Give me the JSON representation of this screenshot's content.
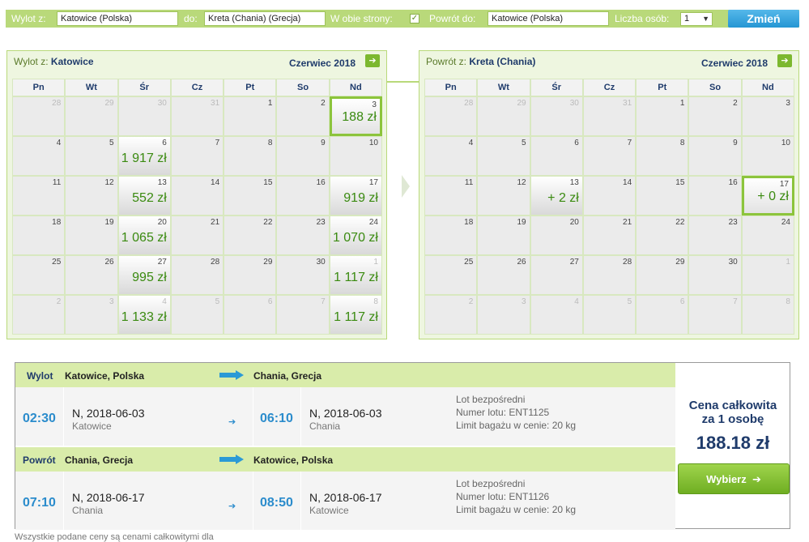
{
  "search": {
    "from_label": "Wylot z:",
    "from_value": "Katowice (Polska)",
    "to_label": "do:",
    "to_value": "Kreta (Chania) (Grecja)",
    "roundtrip_label": "W obie strony:",
    "roundtrip_checked": "✓",
    "return_label": "Powrót do:",
    "return_value": "Katowice (Polska)",
    "persons_label": "Liczba osób:",
    "persons_value": "1",
    "submit": "Zmień"
  },
  "weekdays": [
    "Pn",
    "Wt",
    "Śr",
    "Cz",
    "Pt",
    "So",
    "Nd"
  ],
  "outbound": {
    "title_prefix": "Wylot z:",
    "title_city": "Katowice",
    "month": "Czerwiec 2018",
    "next_icon": "arrow-right-icon",
    "days": [
      {
        "n": "28",
        "f": 1
      },
      {
        "n": "29",
        "f": 1
      },
      {
        "n": "30",
        "f": 1
      },
      {
        "n": "31",
        "f": 1
      },
      {
        "n": "1"
      },
      {
        "n": "2"
      },
      {
        "n": "3",
        "p": "188 zł",
        "s": 1
      },
      {
        "n": "4"
      },
      {
        "n": "5"
      },
      {
        "n": "6",
        "p": "1 917 zł"
      },
      {
        "n": "7"
      },
      {
        "n": "8"
      },
      {
        "n": "9"
      },
      {
        "n": "10"
      },
      {
        "n": "11"
      },
      {
        "n": "12"
      },
      {
        "n": "13",
        "p": "552 zł"
      },
      {
        "n": "14"
      },
      {
        "n": "15"
      },
      {
        "n": "16"
      },
      {
        "n": "17",
        "p": "919 zł"
      },
      {
        "n": "18"
      },
      {
        "n": "19"
      },
      {
        "n": "20",
        "p": "1 065 zł"
      },
      {
        "n": "21"
      },
      {
        "n": "22"
      },
      {
        "n": "23"
      },
      {
        "n": "24",
        "p": "1 070 zł"
      },
      {
        "n": "25"
      },
      {
        "n": "26"
      },
      {
        "n": "27",
        "p": "995 zł"
      },
      {
        "n": "28"
      },
      {
        "n": "29"
      },
      {
        "n": "30"
      },
      {
        "n": "1",
        "f": 1,
        "p": "1 117 zł"
      },
      {
        "n": "2",
        "f": 1
      },
      {
        "n": "3",
        "f": 1
      },
      {
        "n": "4",
        "f": 1,
        "p": "1 133 zł"
      },
      {
        "n": "5",
        "f": 1
      },
      {
        "n": "6",
        "f": 1
      },
      {
        "n": "7",
        "f": 1
      },
      {
        "n": "8",
        "f": 1,
        "p": "1 117 zł"
      }
    ]
  },
  "return": {
    "title_prefix": "Powrót z:",
    "title_city": "Kreta (Chania)",
    "month": "Czerwiec 2018",
    "next_icon": "arrow-right-icon",
    "days": [
      {
        "n": "28",
        "f": 1
      },
      {
        "n": "29",
        "f": 1
      },
      {
        "n": "30",
        "f": 1
      },
      {
        "n": "31",
        "f": 1
      },
      {
        "n": "1"
      },
      {
        "n": "2"
      },
      {
        "n": "3"
      },
      {
        "n": "4"
      },
      {
        "n": "5"
      },
      {
        "n": "6"
      },
      {
        "n": "7"
      },
      {
        "n": "8"
      },
      {
        "n": "9"
      },
      {
        "n": "10"
      },
      {
        "n": "11"
      },
      {
        "n": "12"
      },
      {
        "n": "13",
        "p": "+ 2 zł"
      },
      {
        "n": "14"
      },
      {
        "n": "15"
      },
      {
        "n": "16"
      },
      {
        "n": "17",
        "p": "+ 0 zł",
        "s": 1
      },
      {
        "n": "18"
      },
      {
        "n": "19"
      },
      {
        "n": "20"
      },
      {
        "n": "21"
      },
      {
        "n": "22"
      },
      {
        "n": "23"
      },
      {
        "n": "24"
      },
      {
        "n": "25"
      },
      {
        "n": "26"
      },
      {
        "n": "27"
      },
      {
        "n": "28"
      },
      {
        "n": "29"
      },
      {
        "n": "30"
      },
      {
        "n": "1",
        "f": 1
      },
      {
        "n": "2",
        "f": 1
      },
      {
        "n": "3",
        "f": 1
      },
      {
        "n": "4",
        "f": 1
      },
      {
        "n": "5",
        "f": 1
      },
      {
        "n": "6",
        "f": 1
      },
      {
        "n": "7",
        "f": 1
      },
      {
        "n": "8",
        "f": 1
      }
    ]
  },
  "summary": {
    "out_label": "Wylot",
    "out_from": "Katowice, Polska",
    "out_to": "Chania, Grecja",
    "out_dep_time": "02:30",
    "out_dep_date": "N, 2018-06-03",
    "out_dep_city": "Katowice",
    "out_arr_time": "06:10",
    "out_arr_date": "N, 2018-06-03",
    "out_arr_city": "Chania",
    "out_info1": "Lot bezpośredni",
    "out_info2": "Numer lotu: ENT1125",
    "out_info3": "Limit bagażu w cenie: 20 kg",
    "ret_label": "Powrót",
    "ret_from": "Chania, Grecja",
    "ret_to": "Katowice, Polska",
    "ret_dep_time": "07:10",
    "ret_dep_date": "N, 2018-06-17",
    "ret_dep_city": "Chania",
    "ret_arr_time": "08:50",
    "ret_arr_date": "N, 2018-06-17",
    "ret_arr_city": "Katowice",
    "ret_info1": "Lot bezpośredni",
    "ret_info2": "Numer lotu: ENT1126",
    "ret_info3": "Limit bagażu w cenie: 20 kg",
    "price_heading_1": "Cena całkowita",
    "price_heading_2": "za 1 osobę",
    "price": "188.18 zł",
    "select_button": "Wybierz",
    "arrow_glyph": "➔",
    "mini_arrow": "➔"
  },
  "footnote": "Wszystkie podane ceny są cenami całkowitymi dla"
}
